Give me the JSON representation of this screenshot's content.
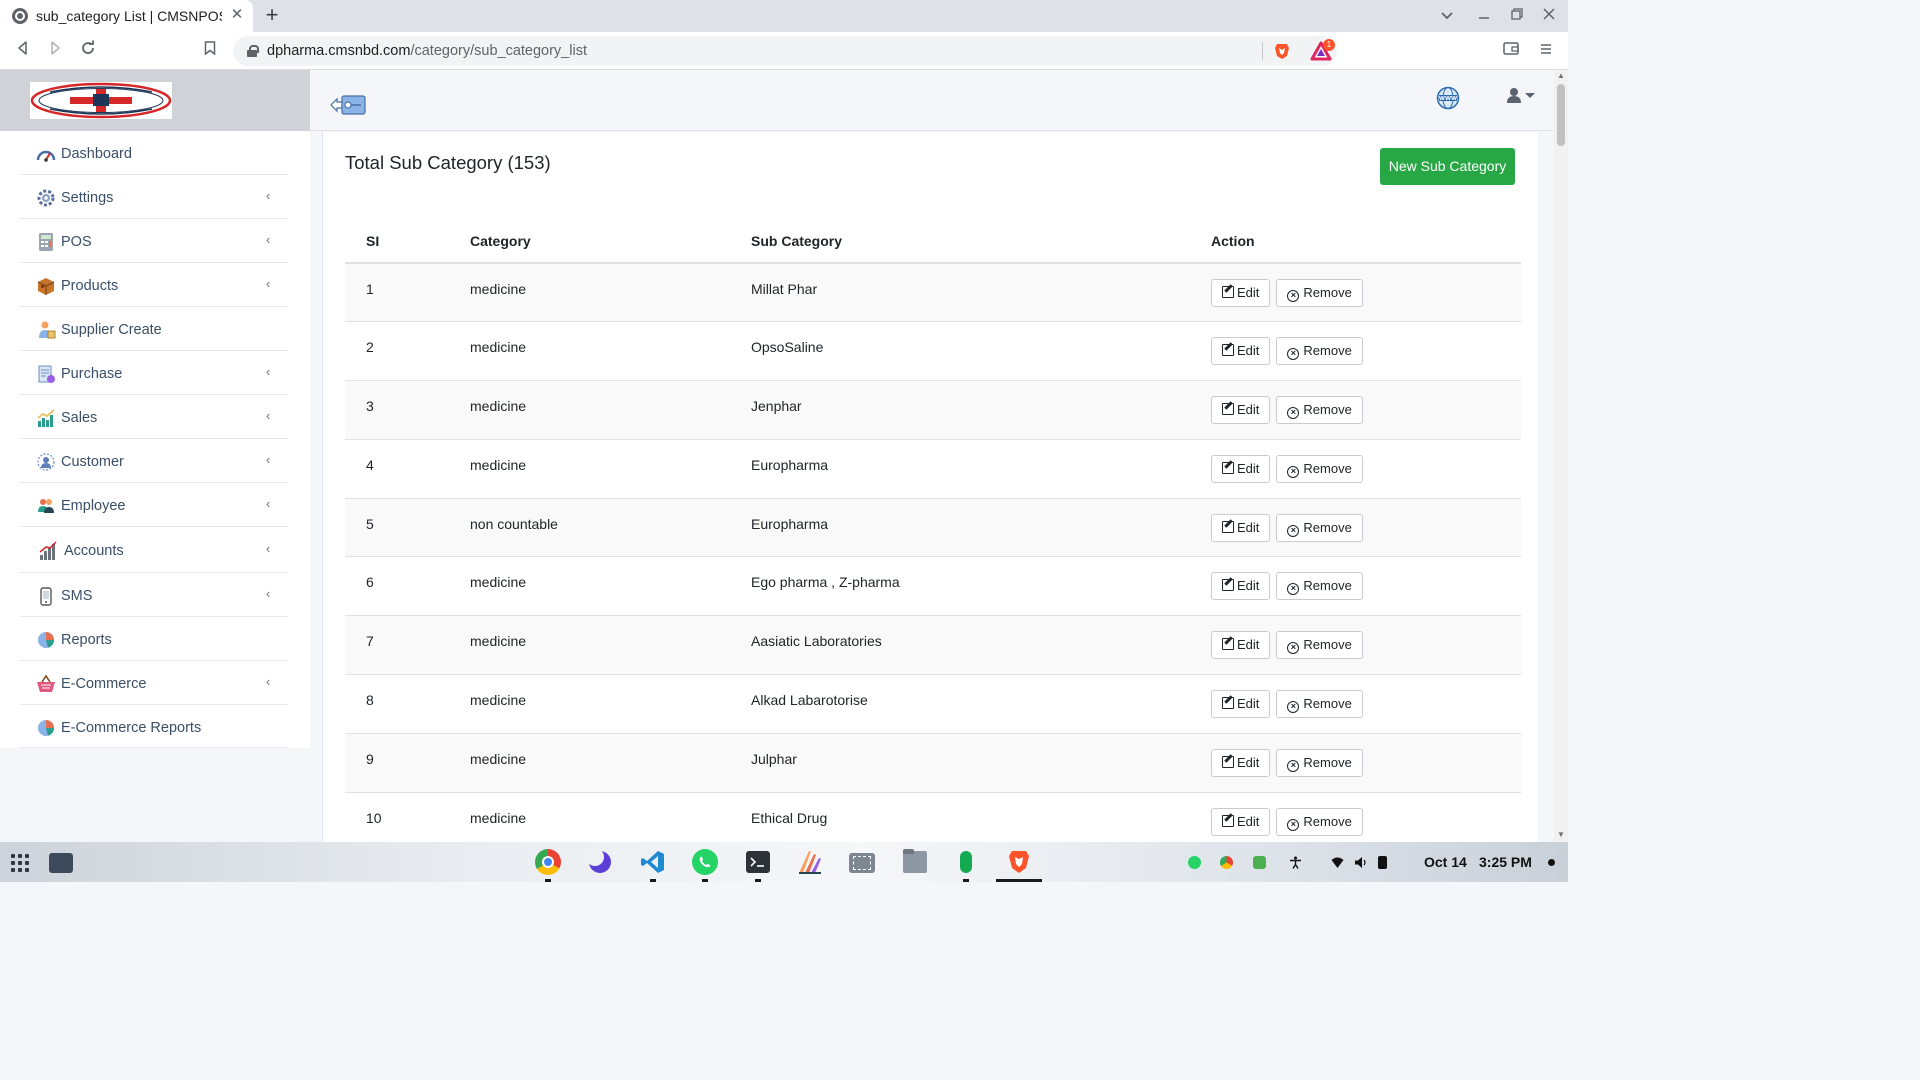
{
  "browser": {
    "tab_title": "sub_category List | CMSNPOS",
    "tab_close": "✕",
    "new_tab": "+",
    "url_host": "dpharma.cmsnbd.com",
    "url_path": "/category/sub_category_list",
    "rewards_badge": "1"
  },
  "sidebar": {
    "items": [
      {
        "label": "Dashboard",
        "icon": "dashboard-icon",
        "has_submenu": false
      },
      {
        "label": "Settings",
        "icon": "gear-icon",
        "has_submenu": true
      },
      {
        "label": "POS",
        "icon": "calculator-icon",
        "has_submenu": true
      },
      {
        "label": "Products",
        "icon": "box-icon",
        "has_submenu": true
      },
      {
        "label": "Supplier Create",
        "icon": "supplier-icon",
        "has_submenu": false
      },
      {
        "label": "Purchase",
        "icon": "purchase-icon",
        "has_submenu": true
      },
      {
        "label": "Sales",
        "icon": "chart-up-icon",
        "has_submenu": true
      },
      {
        "label": "Customer",
        "icon": "customer-icon",
        "has_submenu": true
      },
      {
        "label": "Employee",
        "icon": "employee-icon",
        "has_submenu": true
      },
      {
        "label": "Accounts",
        "icon": "bar-chart-icon",
        "has_submenu": true
      },
      {
        "label": "SMS",
        "icon": "sms-icon",
        "has_submenu": true
      },
      {
        "label": "Reports",
        "icon": "pie-chart-icon",
        "has_submenu": false
      },
      {
        "label": "E-Commerce",
        "icon": "basket-icon",
        "has_submenu": true
      },
      {
        "label": "E-Commerce Reports",
        "icon": "pie-chart-icon",
        "has_submenu": false
      }
    ],
    "chevron": "‹"
  },
  "page": {
    "title": "Total Sub Category (153)",
    "new_button": "New Sub Category"
  },
  "table": {
    "headers": {
      "si": "SI",
      "category": "Category",
      "sub_category": "Sub Category",
      "action": "Action"
    },
    "edit_label": "Edit",
    "remove_label": "Remove",
    "rows": [
      {
        "si": "1",
        "category": "medicine",
        "sub_category": "Millat Phar"
      },
      {
        "si": "2",
        "category": "medicine",
        "sub_category": "OpsoSaline"
      },
      {
        "si": "3",
        "category": "medicine",
        "sub_category": "Jenphar"
      },
      {
        "si": "4",
        "category": "medicine",
        "sub_category": "Europharma"
      },
      {
        "si": "5",
        "category": "non countable",
        "sub_category": "Europharma"
      },
      {
        "si": "6",
        "category": "medicine",
        "sub_category": "Ego pharma , Z-pharma"
      },
      {
        "si": "7",
        "category": "medicine",
        "sub_category": "Aasiatic Laboratories"
      },
      {
        "si": "8",
        "category": "medicine",
        "sub_category": "Alkad Labarotorise"
      },
      {
        "si": "9",
        "category": "medicine",
        "sub_category": "Julphar"
      },
      {
        "si": "10",
        "category": "medicine",
        "sub_category": "Ethical Drug"
      }
    ]
  },
  "taskbar": {
    "date": "Oct 14",
    "time": "3:25 PM"
  },
  "colors": {
    "accent_green": "#28a745",
    "sidebar_text": "#3a4f66",
    "brave_orange": "#fb542b"
  }
}
